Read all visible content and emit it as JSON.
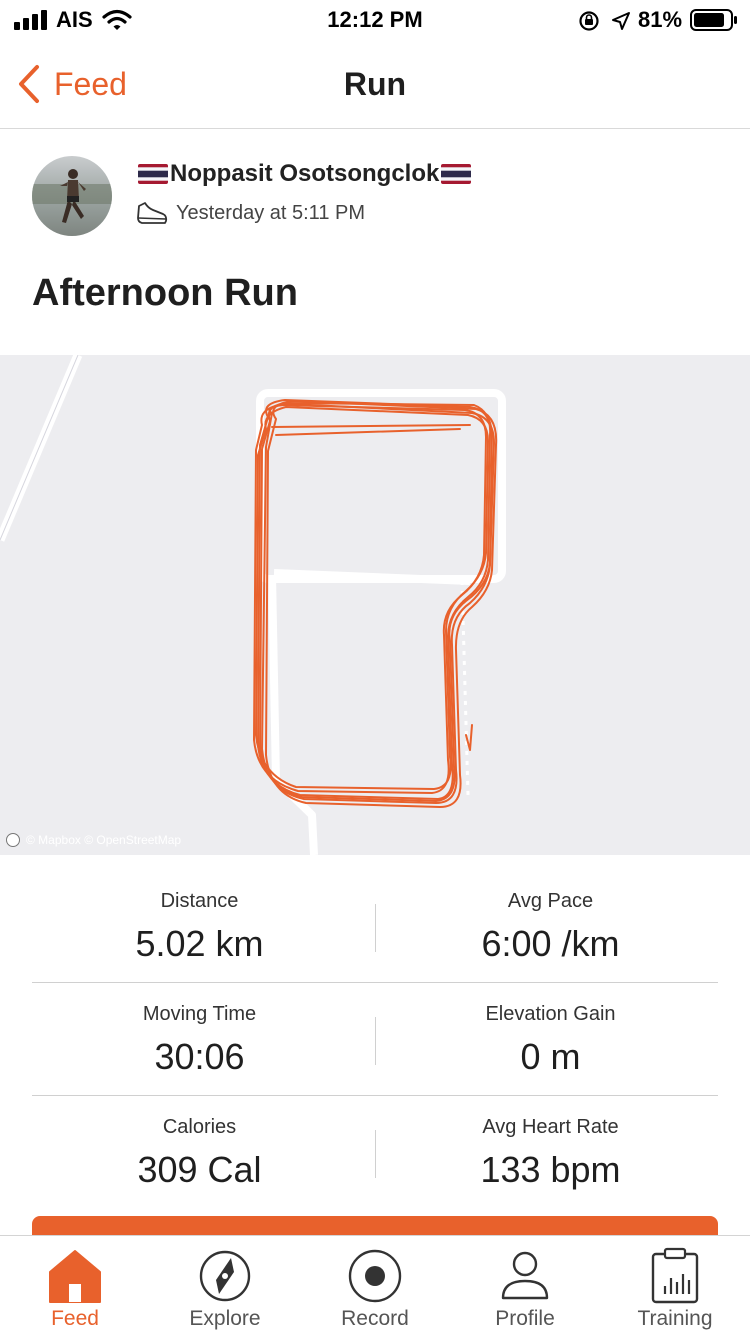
{
  "status_bar": {
    "carrier": "AIS",
    "time": "12:12 PM",
    "battery": "81%"
  },
  "nav": {
    "back_label": "Feed",
    "title": "Run"
  },
  "activity": {
    "athlete": "Noppasit Osotsongclok",
    "time": "Yesterday at 5:11 PM",
    "title": "Afternoon Run"
  },
  "map": {
    "attribution": "© Mapbox © OpenStreetMap",
    "route_color": "#e8612c"
  },
  "stats": [
    {
      "label": "Distance",
      "value": "5.02 km"
    },
    {
      "label": "Avg Pace",
      "value": "6:00 /km"
    },
    {
      "label": "Moving Time",
      "value": "30:06"
    },
    {
      "label": "Elevation Gain",
      "value": "0 m"
    },
    {
      "label": "Calories",
      "value": "309 Cal"
    },
    {
      "label": "Avg Heart Rate",
      "value": "133 bpm"
    }
  ],
  "tabs": [
    {
      "label": "Feed",
      "icon": "home-icon",
      "active": true
    },
    {
      "label": "Explore",
      "icon": "compass-icon",
      "active": false
    },
    {
      "label": "Record",
      "icon": "record-icon",
      "active": false
    },
    {
      "label": "Profile",
      "icon": "person-icon",
      "active": false
    },
    {
      "label": "Training",
      "icon": "clipboard-chart-icon",
      "active": false
    }
  ],
  "colors": {
    "accent": "#e8612c"
  }
}
